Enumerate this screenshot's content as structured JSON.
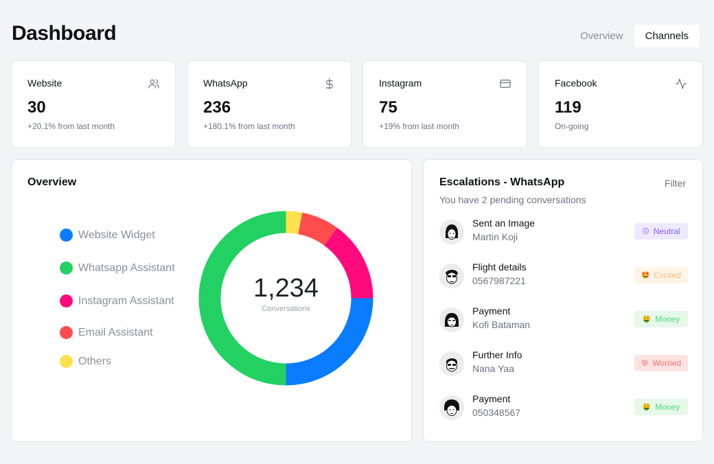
{
  "header": {
    "title": "Dashboard",
    "tabs": [
      {
        "label": "Overview",
        "active": false
      },
      {
        "label": "Channels",
        "active": true
      }
    ]
  },
  "stats": [
    {
      "label": "Website",
      "value": "30",
      "sub": "+20.1% from last month",
      "icon": "users-icon"
    },
    {
      "label": "WhatsApp",
      "value": "236",
      "sub": "+180.1% from last month",
      "icon": "dollar-icon"
    },
    {
      "label": "Instagram",
      "value": "75",
      "sub": "+19% from last month",
      "icon": "credit-card-icon"
    },
    {
      "label": "Facebook",
      "value": "119",
      "sub": "On-going",
      "icon": "activity-icon"
    }
  ],
  "overview": {
    "title": "Overview",
    "legend": [
      {
        "label": "Website Widget",
        "color": "#0a7cff"
      },
      {
        "label": "Whatsapp Assistant",
        "color": "#22d162"
      },
      {
        "label": "Instagram Assistant",
        "color": "#ff0a7c"
      },
      {
        "label": "Email Assistant",
        "color": "#ff4d4d"
      },
      {
        "label": "Others",
        "color": "#ffe14d"
      }
    ],
    "total": "1,234",
    "total_label": "Conversations"
  },
  "chart_data": {
    "type": "pie",
    "categories": [
      "Website Widget",
      "Whatsapp Assistant",
      "Instagram Assistant",
      "Email Assistant",
      "Others"
    ],
    "values": [
      25,
      50,
      15,
      7,
      3
    ],
    "colors": [
      "#0a7cff",
      "#22d162",
      "#ff0a7c",
      "#ff4d4d",
      "#ffe14d"
    ],
    "title": "",
    "legend": "left"
  },
  "escalations": {
    "title": "Escalations - WhatsApp",
    "filter_label": "Filter",
    "subtitle": "You have 2 pending conversations",
    "items": [
      {
        "title": "Sent an Image",
        "person": "Martin Koji",
        "badge": "Neutral",
        "emoji": "😐",
        "bg": "#ede9fe",
        "fg": "#8b5cf6"
      },
      {
        "title": "Flight details",
        "person": "0567987221",
        "badge": "Excited",
        "emoji": "🤩",
        "bg": "#fff4e5",
        "fg": "#fbbf8a"
      },
      {
        "title": "Payment",
        "person": "Kofi Bataman",
        "badge": "Money",
        "emoji": "🤑",
        "bg": "#e6f8ea",
        "fg": "#4ade80"
      },
      {
        "title": "Further Info",
        "person": "Nana Yaa",
        "badge": "Worried",
        "emoji": "😰",
        "bg": "#fee2e2",
        "fg": "#f87171"
      },
      {
        "title": "Payment",
        "person": "050348567",
        "badge": "Money",
        "emoji": "🤑",
        "bg": "#e6f8ea",
        "fg": "#4ade80"
      }
    ]
  }
}
